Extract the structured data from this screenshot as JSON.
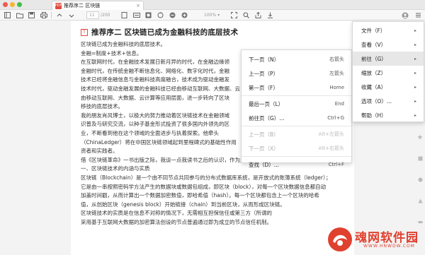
{
  "window": {
    "tab_title": "推荐序二 区块链",
    "pdf_badge": "PDF",
    "tab_close": "×"
  },
  "toolbar": {
    "page_current": "11",
    "page_total": "/200",
    "zoom": "100%",
    "zoom_arrow": "▾"
  },
  "document": {
    "title_icon": "T",
    "title": "推荐序二 区块链已成为金融科技的底层技术",
    "lines": [
      "区块链已成为金融科技的底层技术。",
      "金融=制度+技术+信息。",
      "在互联网时代，在金融技术发展日新月异的时代，在金融边缘领",
      "金融时代，在传统金融不断信息化、网络化、数字化时代，金融",
      "技术已经将金融信息与金融科技高度融合，技术成为驱动金融发",
      "技术时代，驱动金融发展的金融科技已经由移动互联网、大数据、云",
      "由移动互联网、大数据、云计算等应用层面，进一步转向了区块",
      "移技的底层技术。",
      "我的朋友肖风博士，以极大的努力推动着区块链技术在金融领域",
      "识普及与研究交流，以种子基金形式投资了很多国内外领先的区",
      "业，不断看到他在这个领域的全面进步与执着探索。他牵头",
      "（ChinaLedger）将在中国区块链领域起到里程碑式的基础性作用",
      "资者和实践者。",
      "借《区块链革命》一书出版之际，我谈一点我读书之后的认识，作为此书作者的一种致意。",
      "一、区块链技术的内涵与实质",
      "区块链（Blockchain）是一个由不同节点共同参与的分布式数据库系统，是开放式的账簿系统（ledger）；",
      "它是由一串按照密码学方法产生的数据块或数据包组成，即区块（block），对每一个区块数据信息都自动",
      "加盖时间戳，从而计算出一个数据加密数值，即哈希值（hash）。每一个区块都包含上一个区块的哈希",
      "值，从创始区块（genesis block）开始链接（chain）到当前区块，从而形成区块链。",
      "区块链技术的实质是在信息不对称的情况下，无需相互担保信任或第三方（所谓的",
      "采用基于互联网大数据的加密算法创设的节点普遍通过即为成立的节点信任机制。"
    ]
  },
  "submenu": {
    "items": [
      {
        "label": "下一页（N）",
        "shortcut": "右箭头",
        "disabled": false
      },
      {
        "label": "上一页（P）",
        "shortcut": "左箭头",
        "disabled": false
      },
      {
        "label": "第一页（F）",
        "shortcut": "Home",
        "disabled": false
      },
      {
        "label": "最后一页（L）",
        "shortcut": "End",
        "disabled": false
      },
      {
        "label": "前往页（G）...",
        "shortcut": "Ctrl+G",
        "disabled": false
      },
      {
        "label": "上一页（B）",
        "shortcut": "Alt+左箭头",
        "disabled": true
      },
      {
        "label": "下一页（X）",
        "shortcut": "Alt+右箭头",
        "disabled": true
      },
      {
        "label": "查找（D）...",
        "shortcut": "Ctrl+F",
        "disabled": false
      }
    ]
  },
  "mainmenu": {
    "items": [
      {
        "label": "文件（F）",
        "arrow": "▸"
      },
      {
        "label": "查看（V）",
        "arrow": "▸"
      },
      {
        "label": "前往（G）",
        "arrow": "▸"
      },
      {
        "label": "缩放（Z）",
        "arrow": "▸"
      },
      {
        "label": "收藏（A）",
        "arrow": "▸"
      },
      {
        "label": "选项（O）...",
        "arrow": "▸"
      },
      {
        "label": "帮助（H）",
        "arrow": "▸"
      }
    ]
  },
  "watermark": {
    "name": "魂网软件园",
    "url": "WWW.HNWDW.COM"
  },
  "colors": {
    "accent": "#e04a3c",
    "watermark": "#e0412f",
    "traffic_red": "#f05a4f",
    "traffic_yellow": "#f5b731",
    "traffic_green": "#3fc046"
  }
}
